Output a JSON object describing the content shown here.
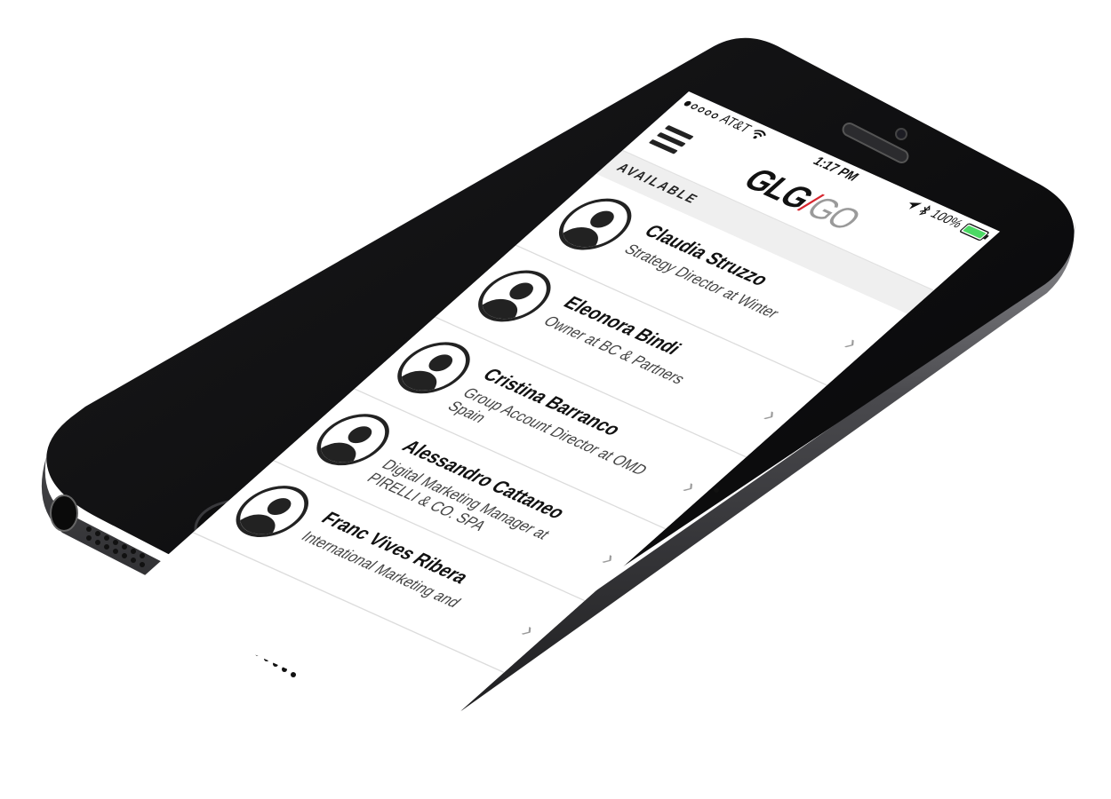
{
  "status_bar": {
    "carrier": "AT&T",
    "signal_dots": [
      true,
      false,
      false,
      false,
      false
    ],
    "time": "1:17 PM",
    "battery_percent": "100%",
    "battery_level": 1.0
  },
  "nav": {
    "logo_primary": "GLG",
    "logo_slash": "/",
    "logo_secondary": "GO"
  },
  "section": {
    "label": "AVAILABLE"
  },
  "contacts": [
    {
      "name": "Claudia Struzzo",
      "title": "Strategy Director at Winter"
    },
    {
      "name": "Eleonora Bindi",
      "title": "Owner at BC & Partners"
    },
    {
      "name": "Cristina Barranco",
      "title": "Group Account Director at OMD Spain"
    },
    {
      "name": "Alessandro Cattaneo",
      "title": "Digital Marketing Manager at PIRELLI & CO. SPA"
    },
    {
      "name": "Franc Vives Ribera",
      "title": "International Marketing and"
    }
  ],
  "colors": {
    "brand_slash": "#d7262f",
    "battery_fill": "#4cd964",
    "phone_body": "#0b0b0c"
  },
  "icons": {
    "menu": "hamburger-icon",
    "wifi": "wifi-icon",
    "location": "location-arrow-icon",
    "bluetooth": "bluetooth-icon",
    "chevron": "chevron-right-icon",
    "avatar": "person-silhouette-icon"
  }
}
